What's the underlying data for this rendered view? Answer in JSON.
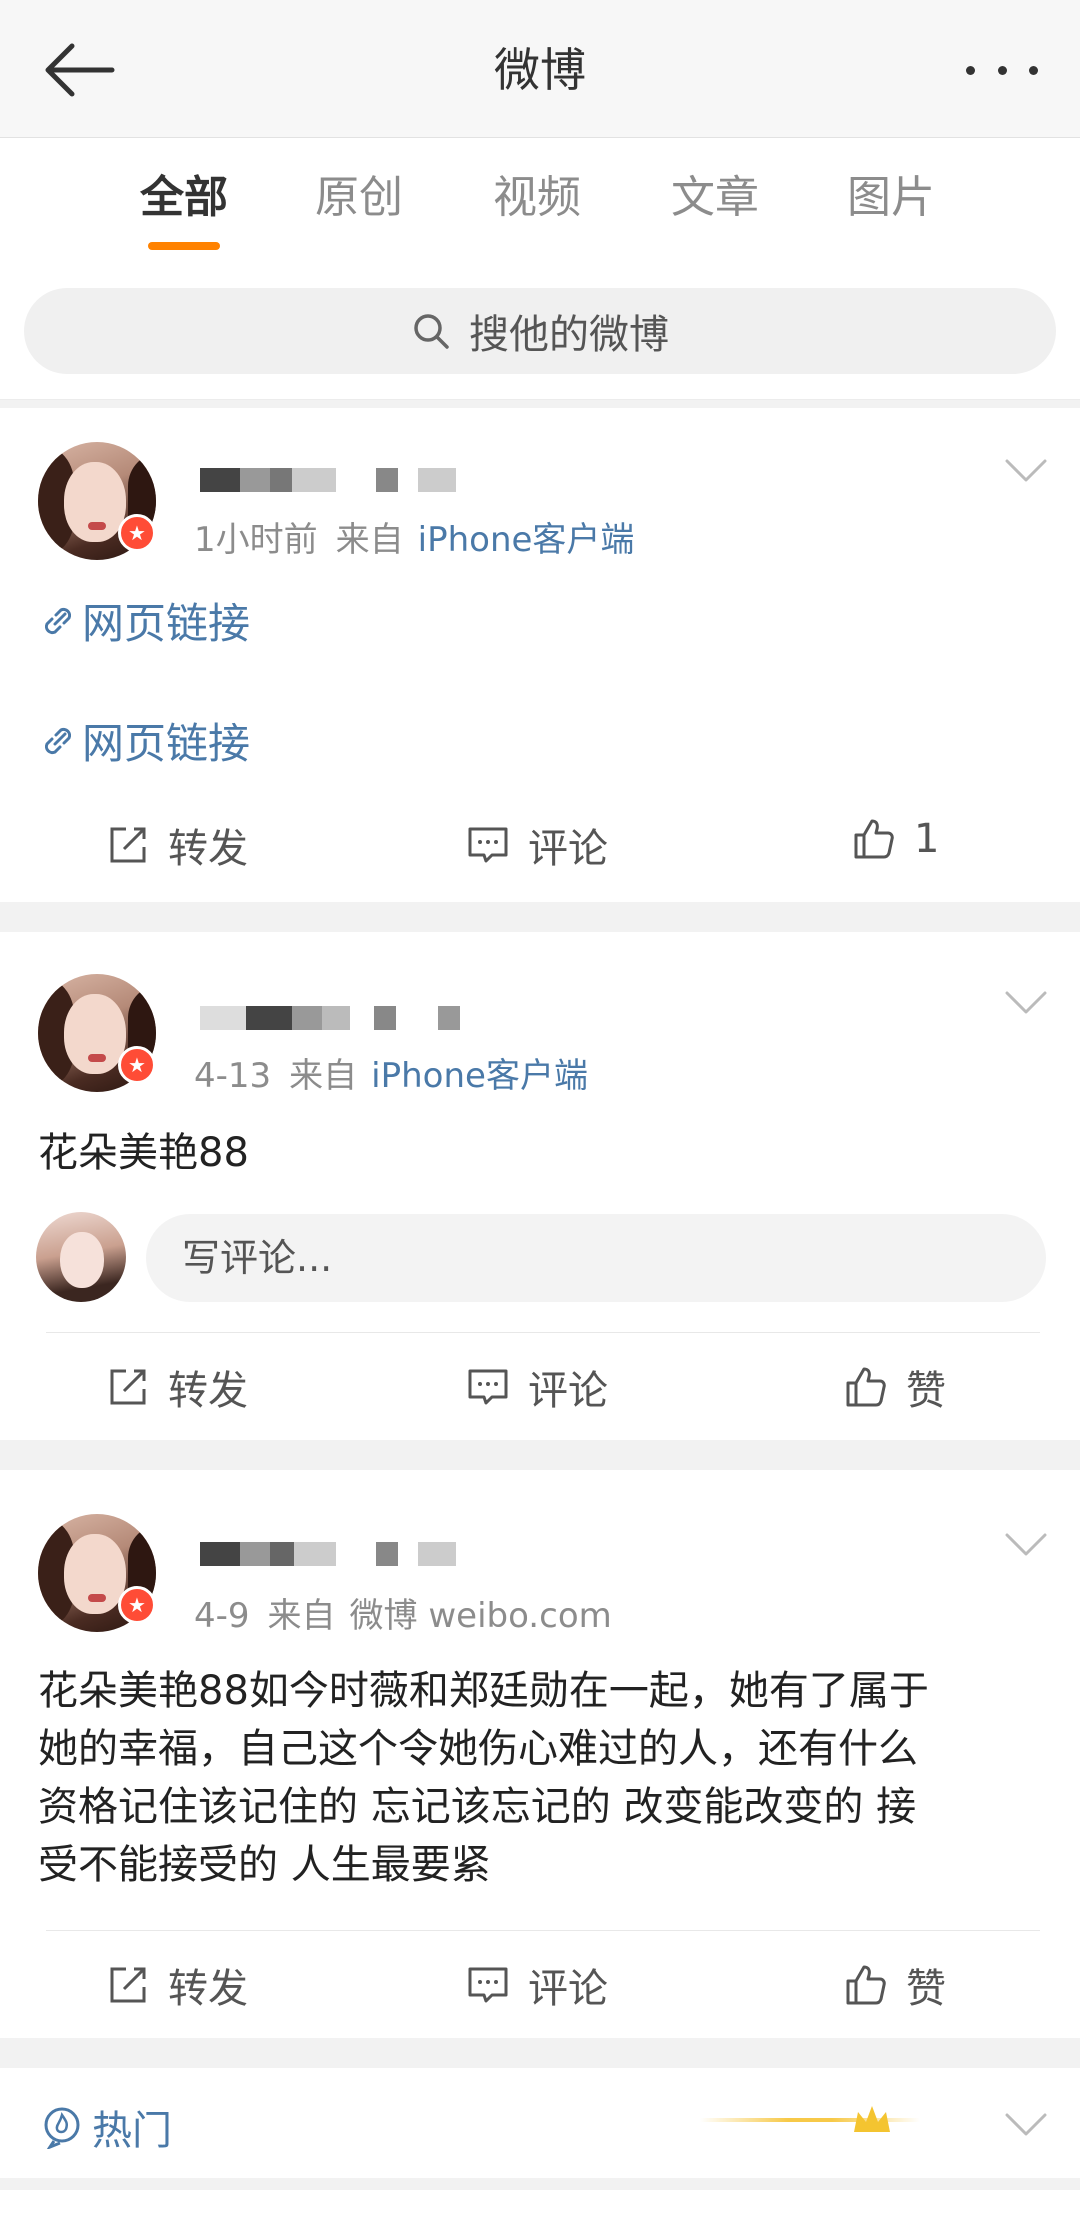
{
  "nav": {
    "title": "微博"
  },
  "tabs": [
    {
      "label": "全部",
      "active": true
    },
    {
      "label": "原创",
      "active": false
    },
    {
      "label": "视频",
      "active": false
    },
    {
      "label": "文章",
      "active": false
    },
    {
      "label": "图片",
      "active": false
    }
  ],
  "search": {
    "placeholder": "搜他的微博"
  },
  "posts": [
    {
      "time": "1小时前",
      "from": "来自",
      "source": "iPhone客户端",
      "links": [
        "网页链接",
        "网页链接"
      ],
      "actions": {
        "repost": "转发",
        "comment": "评论",
        "like": "1"
      }
    },
    {
      "time": "4-13",
      "from": "来自",
      "source": "iPhone客户端",
      "text": "花朵美艳88",
      "comment_placeholder": "写评论...",
      "actions": {
        "repost": "转发",
        "comment": "评论",
        "like": "赞"
      }
    },
    {
      "time": "4-9",
      "from": "来自",
      "source": "微博 weibo.com",
      "text_lines": [
        "花朵美艳88如今时薇和郑廷勋在一起，她有了属于",
        "她的幸福，自己这个令她伤心难过的人，还有什么",
        "资格记住该记住的 忘记该忘记的 改变能改变的 接",
        "受不能接受的 人生最要紧"
      ],
      "actions": {
        "repost": "转发",
        "comment": "评论",
        "like": "赞"
      }
    }
  ],
  "hot": {
    "label": "热门"
  },
  "colors": {
    "accent": "#ff8200",
    "link": "#4a79a8",
    "badge": "#ff4c36"
  }
}
